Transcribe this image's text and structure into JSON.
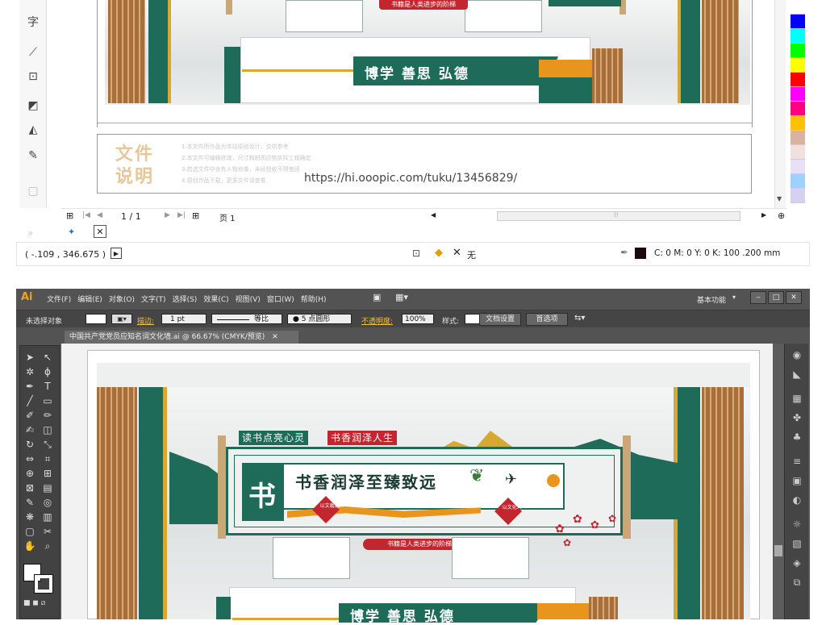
{
  "corel": {
    "left_tool_label": "字",
    "file_note_title_1": "文件",
    "file_note_title_2": "说明",
    "file_note_lines": [
      "1.本文件所作品为本站原创设计，仅供参考",
      "2.本文件可编辑修改，尺寸和材质应依实际工程确定",
      "3.若选文件中含有人物肖像，未经授权不得使用",
      "4.原创作品下载，更多文件请查看"
    ],
    "url_text": "https://hi.ooopic.com/tuku/13456829/",
    "page_indicator": "1 / 1",
    "page_tab": "页 1",
    "coordinates": "( -.109 , 346.675 )",
    "fill_none": "无",
    "color_readout": "C: 0 M: 0 Y: 0 K: 100  .200 mm",
    "palette": [
      "#ffffff",
      "#0000ff",
      "#00ffff",
      "#00ff00",
      "#ffff00",
      "#ff0000",
      "#ff00ff",
      "#ff0080",
      "#ffc000",
      "#d8b4a0",
      "#f0e0e0",
      "#e8e0f8",
      "#a0d0ff",
      "#d8d0f0"
    ]
  },
  "ai": {
    "app_logo": "Ai",
    "menus": [
      "文件(F)",
      "编辑(E)",
      "对象(O)",
      "文字(T)",
      "选择(S)",
      "效果(C)",
      "视图(V)",
      "窗口(W)",
      "帮助(H)"
    ],
    "workspace": "基本功能",
    "control": {
      "no_selection": "未选择对象",
      "stroke_label": "描边:",
      "stroke_value": "1 pt",
      "profile": "等比",
      "brush": "5 点圆形",
      "opacity_label": "不透明度:",
      "opacity_value": "100%",
      "style_label": "样式:",
      "doc_setup": "文档设置",
      "preferences": "首选项"
    },
    "doc_tab": "中国共产党党员应知名词文化墙.ai @ 66.67% (CMYK/预览)"
  },
  "mural": {
    "tag_left": "读书点亮心灵",
    "tag_right": "书香润泽人生",
    "shu_char": "书",
    "headline": "书香润泽至臻致远",
    "seal_left": "以文载道",
    "seal_right": "以文化人",
    "ribbon": "书籍是人类进步的阶梯",
    "motto": "博学 善思 弘德"
  },
  "colors": {
    "green": "#1e6b5a",
    "gold": "#d9a830",
    "orange": "#e8951d",
    "wood": "#a86e3b",
    "red": "#c2262e"
  }
}
